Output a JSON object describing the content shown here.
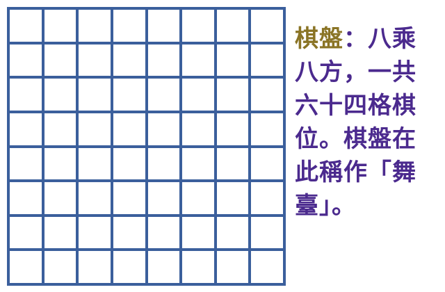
{
  "board": {
    "rows": 8,
    "columns": 8,
    "grid_color": "#3b5f9c",
    "cell_color": "#ffffff"
  },
  "caption": {
    "term": "棋盤",
    "text": "：八乘八方，一共六十四格棋位。棋盤在此稱作「舞臺」。",
    "term_color": "#8a7425",
    "text_color": "#4b2a8e"
  }
}
